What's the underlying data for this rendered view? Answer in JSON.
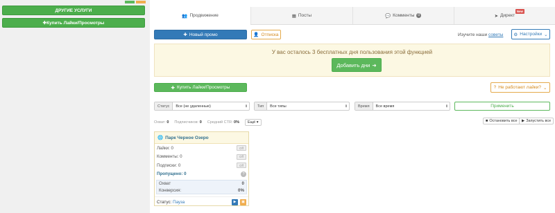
{
  "sidebar": {
    "other_services_label": "ДРУГИЕ УСЛУГИ",
    "buy_likes_label": "Купить Лайки/Просмотры"
  },
  "tabs": [
    {
      "label": "Продвижение",
      "icon": "users-icon",
      "active": true
    },
    {
      "label": "Посты",
      "icon": "grid-icon"
    },
    {
      "label": "Комменты",
      "icon": "comment-icon",
      "count": "0"
    },
    {
      "label": "Директ",
      "icon": "send-icon",
      "badge": "New"
    }
  ],
  "toolbar": {
    "new_promo_label": "Новый промо",
    "unfollow_label": "Отписка",
    "tips_prefix": "Изучите наши",
    "tips_link": "советы",
    "settings_label": "Настройки"
  },
  "notice": {
    "text": "У вас осталось 3 бесплатных дня пользования этой функцией",
    "button_label": "Добавить дни"
  },
  "actions": {
    "buy_likes_label": "Купить Лайки/Просмотры",
    "not_working_label": "Не работают лайки?"
  },
  "filters": {
    "status": {
      "label": "Статус",
      "value": "Все (не удаленные)"
    },
    "type": {
      "label": "Тип",
      "value": "Все типы"
    },
    "time": {
      "label": "Время",
      "value": "Все время"
    },
    "apply_label": "Применить"
  },
  "stats": {
    "reach_label": "Охват:",
    "reach_value": "0",
    "followers_label": "Подписчиков:",
    "followers_value": "0",
    "ctr_label": "Средний CTR:",
    "ctr_value": "0%",
    "more_label": "Ещё"
  },
  "controls": {
    "stop_all_label": "Остановить все",
    "start_all_label": "Запустить все"
  },
  "card": {
    "title": "Парк Черное Озеро",
    "rows": [
      {
        "label": "Лайки: 0",
        "toggle": "Off"
      },
      {
        "label": "Комменты: 0",
        "toggle": "Off"
      },
      {
        "label": "Подписки: 0",
        "toggle": "Off"
      }
    ],
    "skipped_label": "Пропущено: 0",
    "reach_label": "Охват",
    "reach_value": "0",
    "conversion_label": "Конверсия:",
    "conversion_value": "0%",
    "status_label": "Статус:",
    "status_value": "Пауза"
  },
  "colors": {
    "green": "#5cb85c",
    "blue": "#337ab7",
    "orange": "#f0ad4e",
    "notice_bg": "#fcf8e3"
  }
}
